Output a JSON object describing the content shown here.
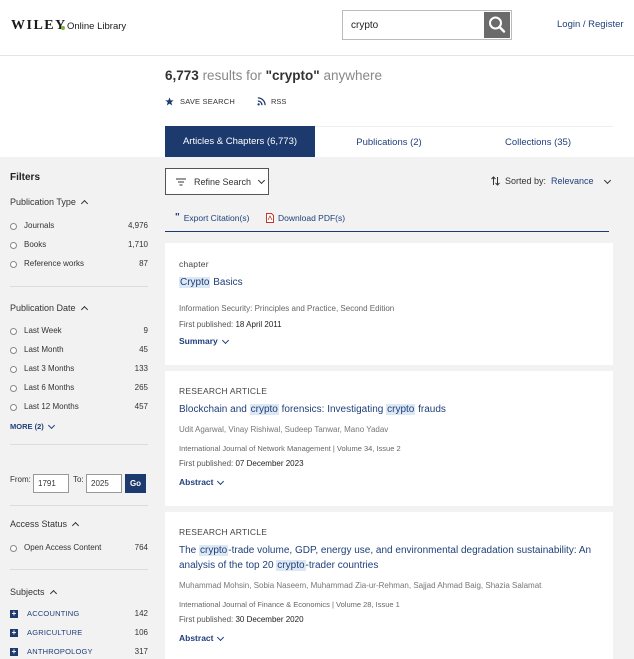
{
  "header": {
    "brand": "WILEY",
    "brand_sub": "Online Library",
    "search_value": "crypto",
    "login_label": "Login / Register"
  },
  "summary": {
    "count": "6,773",
    "results_for": "results for",
    "query": "\"crypto\"",
    "scope": "anywhere",
    "save_search": "SAVE SEARCH",
    "rss": "RSS"
  },
  "tabs": [
    {
      "label": "Articles & Chapters (6,773)",
      "active": true
    },
    {
      "label": "Publications (2)",
      "active": false
    },
    {
      "label": "Collections (35)",
      "active": false
    }
  ],
  "filters": {
    "title": "Filters",
    "publication_type": {
      "label": "Publication Type",
      "items": [
        {
          "label": "Journals",
          "count": "4,976"
        },
        {
          "label": "Books",
          "count": "1,710"
        },
        {
          "label": "Reference works",
          "count": "87"
        }
      ]
    },
    "publication_date": {
      "label": "Publication Date",
      "items": [
        {
          "label": "Last Week",
          "count": "9"
        },
        {
          "label": "Last Month",
          "count": "45"
        },
        {
          "label": "Last 3 Months",
          "count": "133"
        },
        {
          "label": "Last 6 Months",
          "count": "265"
        },
        {
          "label": "Last 12 Months",
          "count": "457"
        }
      ],
      "more": "MORE (2)"
    },
    "range": {
      "from_label": "From:",
      "from": "1791",
      "to_label": "To:",
      "to": "2025",
      "go": "Go"
    },
    "access_status": {
      "label": "Access Status",
      "items": [
        {
          "label": "Open Access Content",
          "count": "764"
        }
      ]
    },
    "subjects": {
      "label": "Subjects",
      "items": [
        {
          "label": "ACCOUNTING",
          "count": "142"
        },
        {
          "label": "AGRICULTURE",
          "count": "106"
        },
        {
          "label": "ANTHROPOLOGY",
          "count": "317"
        }
      ]
    }
  },
  "toolbar": {
    "refine": "Refine Search",
    "sort_label": "Sorted by:",
    "sort_value": "Relevance",
    "export_citations": "Export Citation(s)",
    "download_pdfs": "Download PDF(s)"
  },
  "results": [
    {
      "type": "chapter",
      "title_parts": [
        "Crypto",
        " Basics"
      ],
      "meta": "Information Security: Principles and Practice, Second Edition",
      "published_label": "First published:",
      "published": "18 April 2011",
      "link": "Summary"
    },
    {
      "type": "RESEARCH ARTICLE",
      "title_parts": [
        "Blockchain and ",
        "crypto",
        " forensics: Investigating ",
        "crypto",
        " frauds"
      ],
      "authors": "Udit Agarwal, Vinay Rishiwal, Sudeep Tanwar, Mano Yadav",
      "meta": "International Journal of Network Management | Volume 34, Issue 2",
      "published_label": "First published:",
      "published": "07 December 2023",
      "link": "Abstract"
    },
    {
      "type": "RESEARCH ARTICLE",
      "title_parts": [
        "The ",
        "crypto",
        "-trade volume, GDP, energy use, and environmental degradation sustainability: An analysis of the top 20 ",
        "crypto",
        "-trader countries"
      ],
      "authors": "Muhammad Mohsin, Sobia Naseem, Muhammad Zia-ur-Rehman, Sajjad Ahmad Baig, Shazia Salamat",
      "meta": "International Journal of Finance & Economics | Volume 28, Issue 1",
      "published_label": "First published:",
      "published": "30 December 2020",
      "link": "Abstract"
    }
  ],
  "colors": {
    "brand_navy": "#1d3a6e",
    "link_blue": "#1f3f7a",
    "highlight": "#dde8f5",
    "page_grey": "#f2f2f2"
  }
}
